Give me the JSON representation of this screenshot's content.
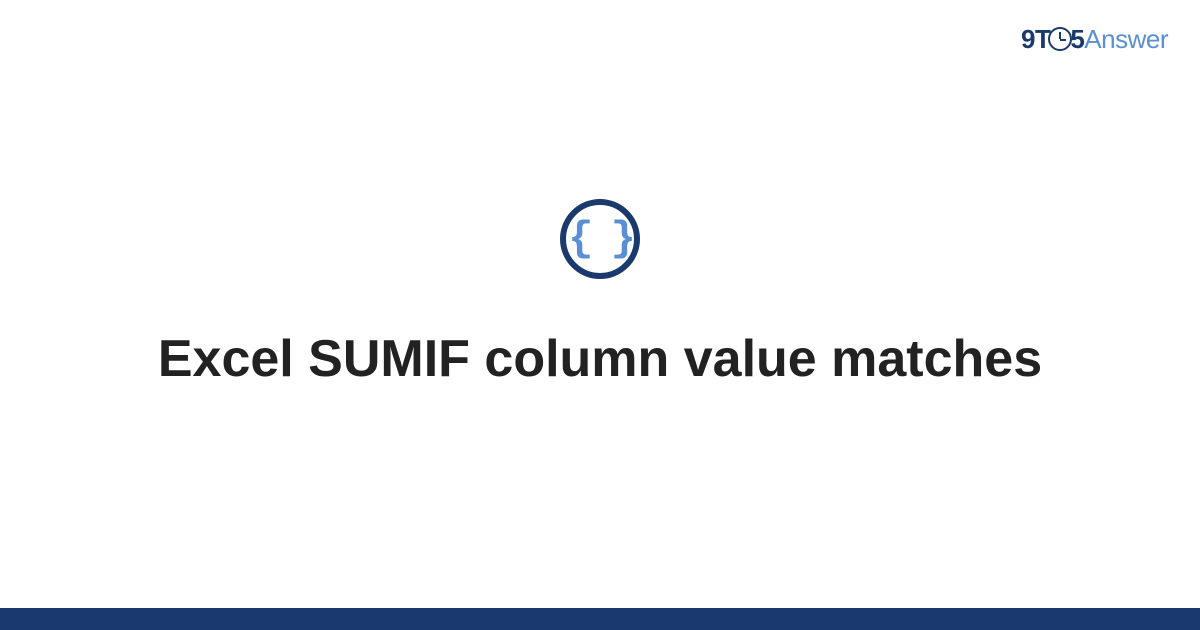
{
  "logo": {
    "part1": "9T",
    "part2": "5",
    "part3": "Answer"
  },
  "icon": {
    "name": "code-braces-icon",
    "glyph": "{ }"
  },
  "title": "Excel SUMIF column value matches",
  "colors": {
    "dark_blue": "#1a3a6e",
    "light_blue": "#5a8fd6",
    "text": "#222222"
  }
}
